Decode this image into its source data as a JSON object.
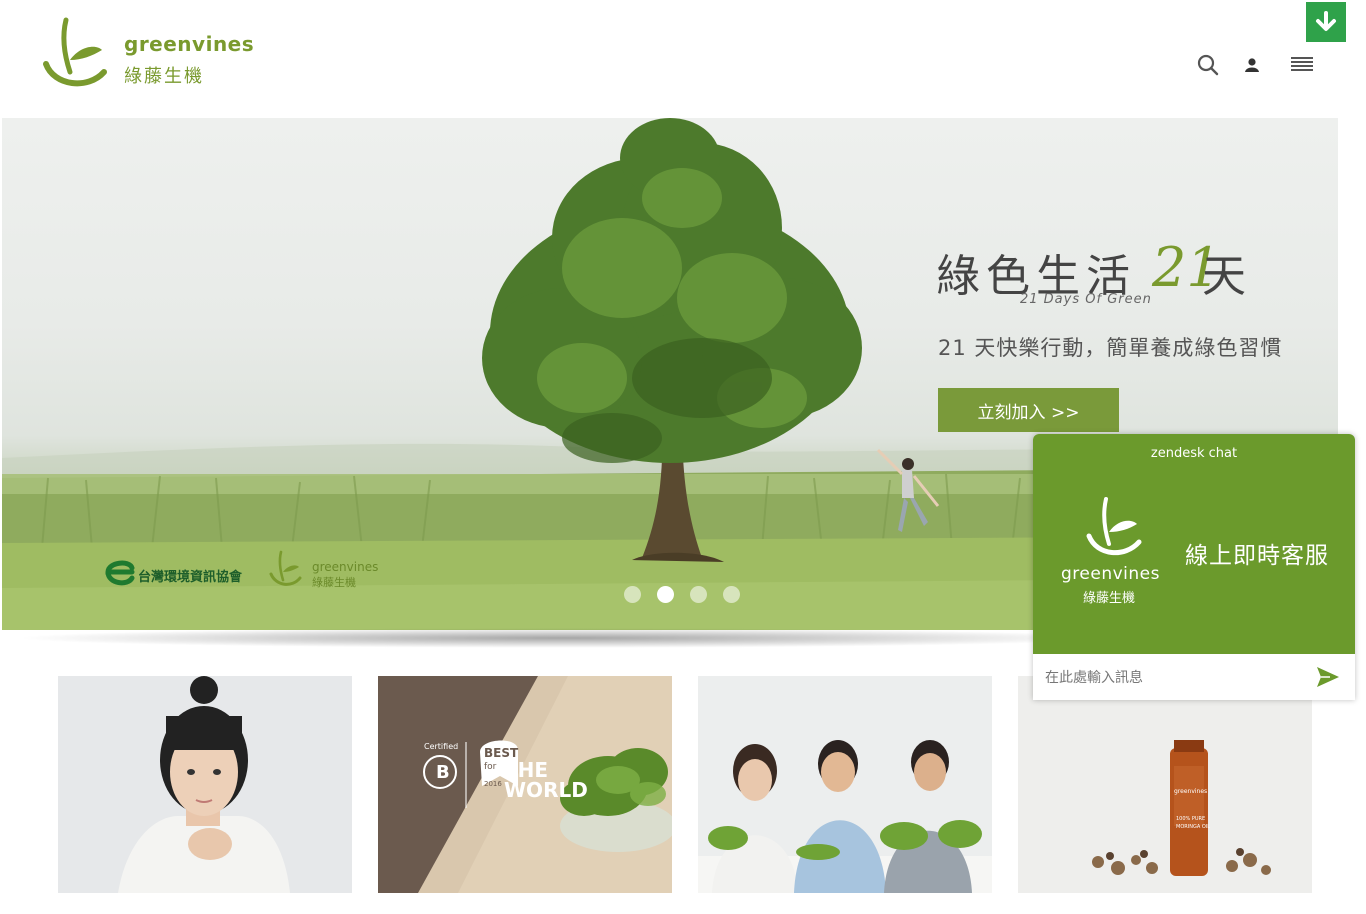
{
  "brand": {
    "name_en": "greenvines",
    "name_zh": "綠藤生機",
    "accent_color": "#7a9a2e"
  },
  "header": {
    "icons": [
      "search-icon",
      "user-icon",
      "menu-icon"
    ],
    "download_icon": "arrow-down-icon"
  },
  "hero": {
    "title": "綠色生活",
    "title_number": "21",
    "title_suffix": "天",
    "title_en": "21 Days Of Green",
    "subtitle": "21 天快樂行動，簡單養成綠色習慣",
    "cta_label": "立刻加入 >>",
    "partner_name": "台灣環境資訊協會",
    "partner_brand_en": "greenvines",
    "partner_brand_zh": "綠藤生機",
    "slides_total": 4,
    "active_slide": 2
  },
  "cards": [
    {
      "subject": "portrait"
    },
    {
      "badge_certified": "Certified",
      "badge_best": "BEST",
      "badge_for": "for",
      "badge_world": "THE WORLD",
      "badge_year": "2016"
    },
    {
      "subject": "team"
    },
    {
      "product_brand": "greenvines",
      "product_label_1": "100% PURE",
      "product_label_2": "MORINGA OIL"
    }
  ],
  "chat": {
    "brand": "zendesk chat",
    "logo_en": "greenvines",
    "logo_zh": "綠藤生機",
    "title": "線上即時客服",
    "input_placeholder": "在此處輸入訊息",
    "color": "#6b9a2c"
  }
}
